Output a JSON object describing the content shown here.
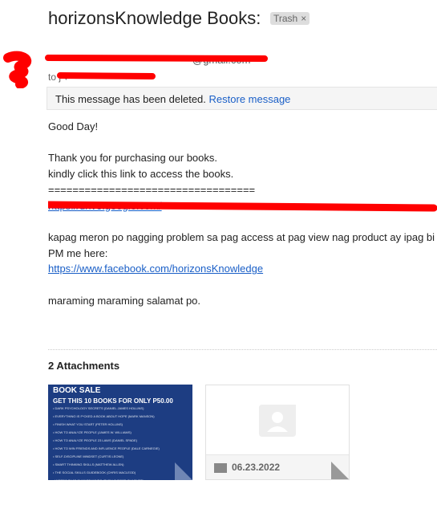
{
  "header": {
    "subject": "horizonsKnowledge Books:",
    "label": "Trash",
    "label_remove": "×"
  },
  "sender": {
    "email_suffix": "@gmail.com",
    "to_prefix": "to"
  },
  "banner": {
    "text": "This message has been deleted.",
    "restore": "Restore message"
  },
  "body": {
    "greeting": "Good Day!",
    "line1": "Thank you for purchasing our books.",
    "line2": "kindly click this link to access the books.",
    "separator": "==================================",
    "link": "https://drive.google.com/",
    "line3": "kapag meron po nagging problem sa pag access at pag view nag product ay ipag bi",
    "line4": "PM me here:",
    "facebook": "https://www.facebook.com/horizonsKnowledge",
    "closing": "maraming maraming salamat po."
  },
  "attachments": {
    "heading": "2 Attachments",
    "items": [
      {
        "title": "BOOK SALE",
        "headline": "GET THIS 10 BOOKS FOR ONLY P50.00",
        "lines": [
          "DARK PSYCHOLOGY SECRETS (DANIEL JAMES HOLLINS)",
          "EVERYTHING IS F*CKED A BOOK ABOUT HOPE (MARK MANSON)",
          "FINISH WHAT YOU START (PETER HOLLINS)",
          "HOW TO ANALYZE PEOPLE (JAMES W. WILLIAMS)",
          "HOW TO ANALYZE PEOPLE 23 LAWS (DANIEL SPADE)",
          "HOW TO WIN FRIENDS AND INFLUENCE PEOPLE (DALE CARNEGIE)",
          "SELF-DISCIPLINE MINDSET (CURTIS LEONE)",
          "SMART THINKING SKILLS (MATTHEW ALLEN)",
          "THE SOCIAL SKILLS GUIDEBOOK (CHRIS MACLEOD)",
          "WORDS THAT CHANGE MINDS (SHELLE ROSE CHARVET)"
        ]
      },
      {
        "name": "06.23.2022"
      }
    ]
  },
  "colors": {
    "link": "#1a5fc7",
    "redaction": "#ff0000",
    "poster": "#1d3d82"
  }
}
